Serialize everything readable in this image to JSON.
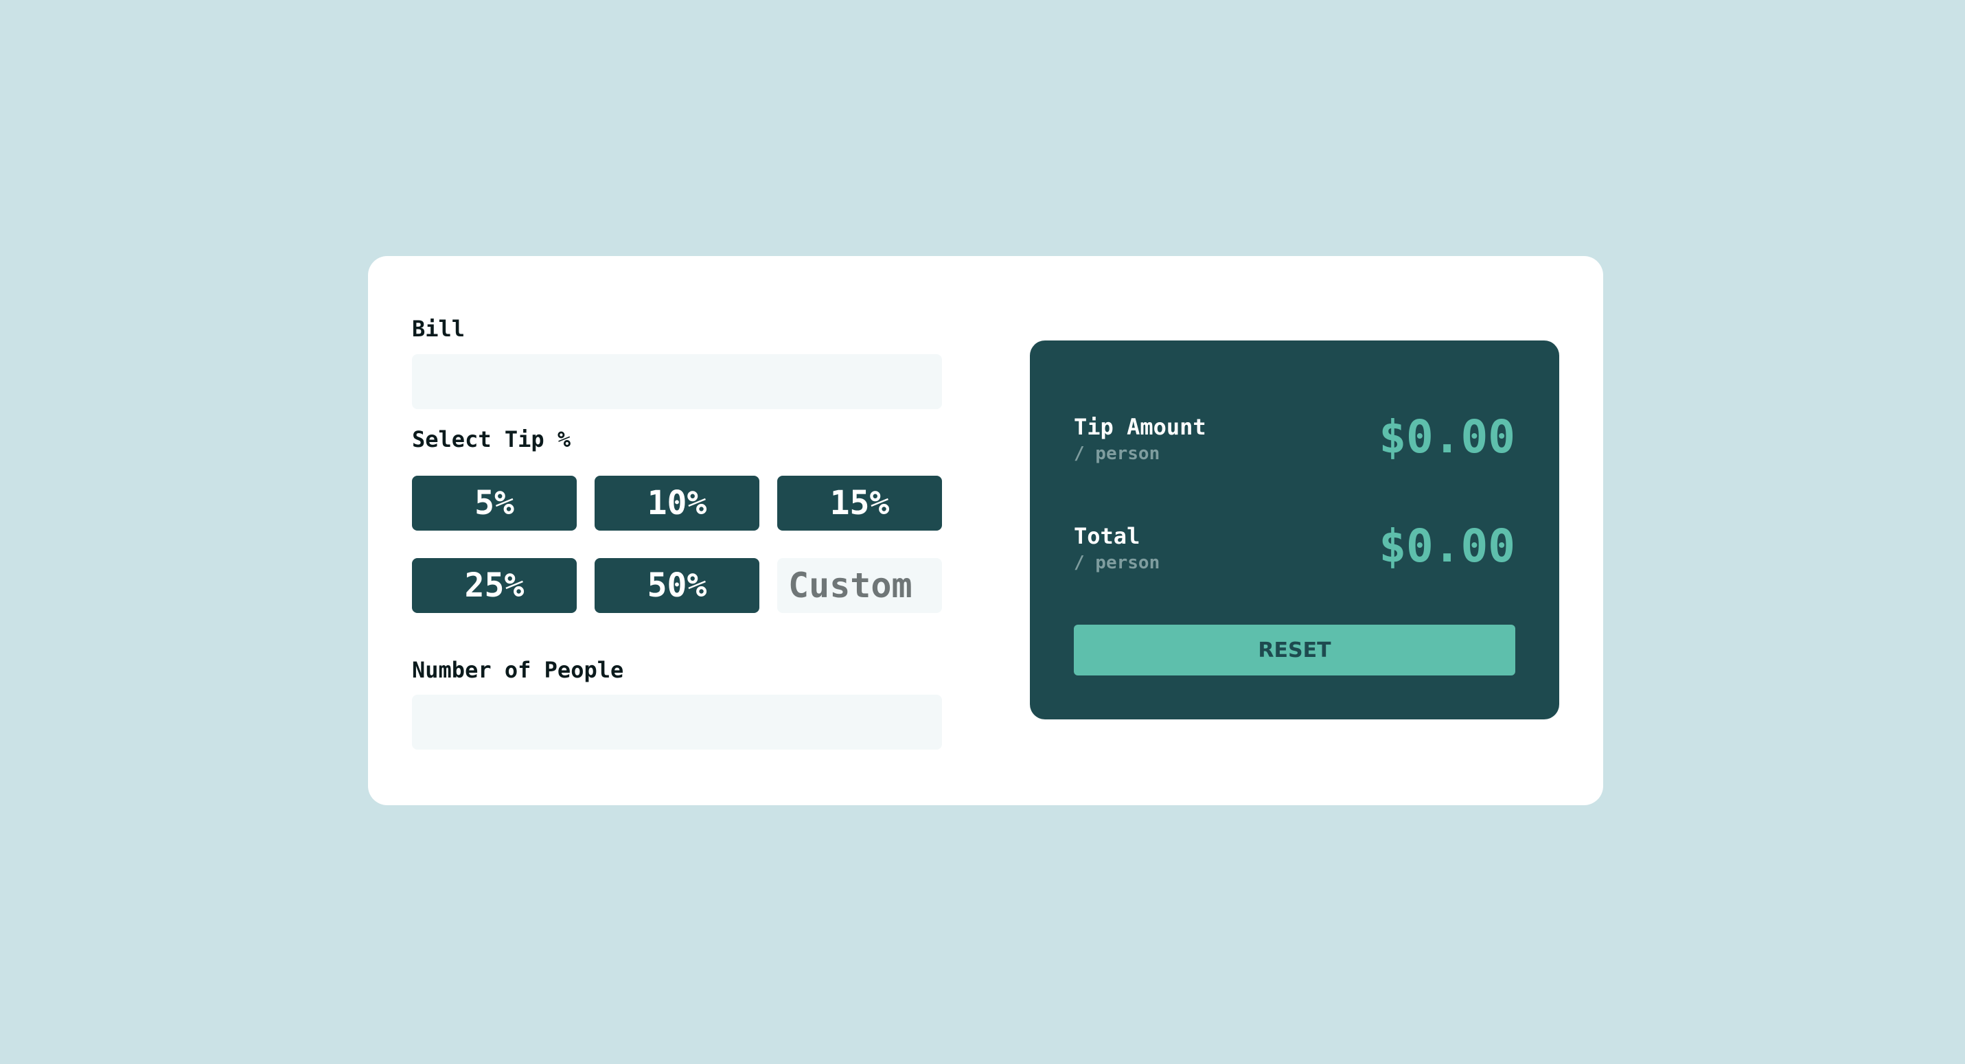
{
  "app": {
    "background_color": "#cbe2e6",
    "accent_color": "#5ebfac",
    "panel_color": "#1e4a4f"
  },
  "form": {
    "bill_label": "Bill",
    "bill_value": "",
    "select_tip_label": "Select Tip %",
    "tip_options": [
      "5%",
      "10%",
      "15%",
      "25%",
      "50%"
    ],
    "custom_placeholder": "Custom",
    "people_label": "Number of People",
    "people_value": ""
  },
  "results": {
    "tip_amount_label": "Tip Amount",
    "tip_amount_sublabel": "/ person",
    "tip_amount_value": "$0.00",
    "total_label": "Total",
    "total_sublabel": "/ person",
    "total_value": "$0.00",
    "reset_label": "RESET"
  }
}
